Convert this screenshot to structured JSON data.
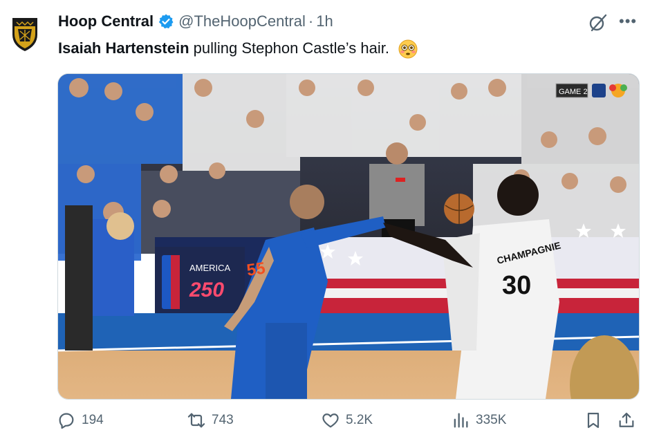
{
  "account": {
    "display_name": "Hoop Central",
    "handle": "@TheHoopCentral",
    "separator": "·",
    "time": "1h",
    "verified_icon": "verified-badge-icon",
    "avatar_icon": "crest-logo"
  },
  "post": {
    "text_bold": "Isaiah Hartenstein",
    "text_rest": " pulling Stephon Castle’s hair.",
    "emoji": "flushed-face-emoji"
  },
  "media": {
    "type": "video-still",
    "overlay_badge": "GAME 2",
    "arena_banner": "AMERICA",
    "arena_banner_number": "250",
    "jersey_back_name": "CHAMPAGNIE",
    "jersey_back_number": "30",
    "jersey_front_number": "55",
    "court_color": "#1f63b6",
    "jersey_blue": "#1f5fc4",
    "jersey_white": "#f3f3f3"
  },
  "actions": {
    "replies": "194",
    "reposts": "743",
    "likes": "5.2K",
    "views": "335K",
    "icons": [
      "reply-icon",
      "repost-icon",
      "like-icon",
      "views-icon",
      "bookmark-icon",
      "share-icon"
    ]
  },
  "colors": {
    "verified_blue": "#1d9bf0",
    "secondary_text": "#536471",
    "primary_text": "#0f1419"
  }
}
